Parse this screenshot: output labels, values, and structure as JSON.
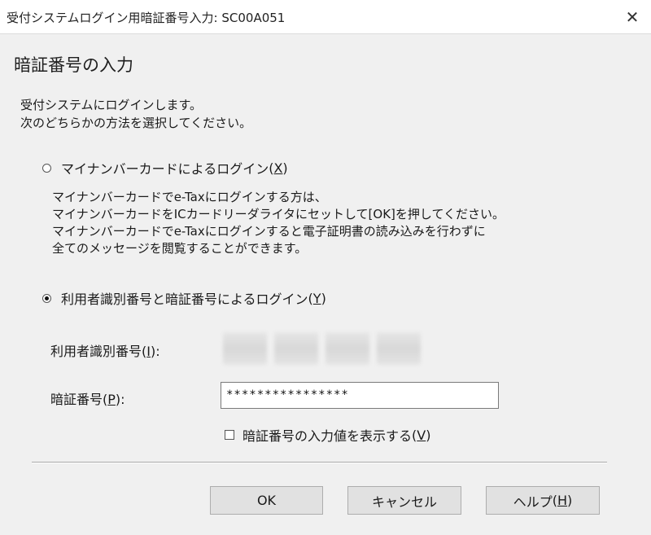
{
  "window": {
    "title": "受付システムログイン用暗証番号入力: SC00A051"
  },
  "heading": "暗証番号の入力",
  "intro": {
    "line1": "受付システムにログインします。",
    "line2": "次のどちらかの方法を選択してください。"
  },
  "option_card": {
    "label": "マイナンバーカードによるログイン",
    "mnemonic_open": "(",
    "mnemonic": "X",
    "mnemonic_close": ")",
    "selected": false,
    "desc": [
      "マイナンバーカードでe-Taxにログインする方は、",
      "マイナンバーカードをICカードリーダライタにセットして[OK]を押してください。",
      "マイナンバーカードでe-Taxにログインすると電子証明書の読み込みを行わずに",
      "全てのメッセージを閲覧することができます。"
    ]
  },
  "option_id": {
    "label": "利用者識別番号と暗証番号によるログイン",
    "mnemonic_open": "(",
    "mnemonic": "Y",
    "mnemonic_close": ")",
    "selected": true
  },
  "user_id": {
    "label": "利用者識別番号",
    "mnemonic": "I",
    "suffix": "):"
  },
  "password": {
    "label": "暗証番号",
    "mnemonic": "P",
    "suffix": "):",
    "value": "****************"
  },
  "show_password": {
    "label": "暗証番号の入力値を表示する",
    "mnemonic": "V",
    "checked": false
  },
  "buttons": {
    "ok": "OK",
    "cancel": "キャンセル",
    "help": "ヘルプ",
    "help_mnemonic": "H"
  }
}
